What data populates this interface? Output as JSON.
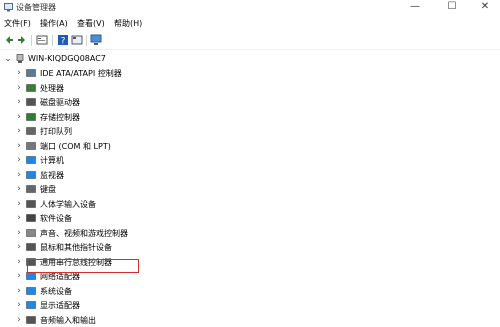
{
  "window": {
    "title": "设备管理器",
    "min": "—",
    "max": "☐",
    "close": "✕"
  },
  "menu": [
    {
      "label": "文件(F)"
    },
    {
      "label": "操作(A)"
    },
    {
      "label": "查看(V)"
    },
    {
      "label": "帮助(H)"
    }
  ],
  "tree": {
    "root": "WIN-KIQDGQ08AC7",
    "items": [
      {
        "label": "IDE ATA/ATAPI 控制器",
        "icon": "ide-controller-icon",
        "color": "#5a7a9a"
      },
      {
        "label": "处理器",
        "icon": "processor-icon",
        "color": "#3a7d3a"
      },
      {
        "label": "磁盘驱动器",
        "icon": "disk-drive-icon",
        "color": "#555555"
      },
      {
        "label": "存储控制器",
        "icon": "storage-controller-icon",
        "color": "#2e7d32"
      },
      {
        "label": "打印队列",
        "icon": "printer-icon",
        "color": "#666666"
      },
      {
        "label": "端口 (COM 和 LPT)",
        "icon": "port-icon",
        "color": "#777777"
      },
      {
        "label": "计算机",
        "icon": "computer-icon",
        "color": "#1e88e5"
      },
      {
        "label": "监视器",
        "icon": "monitor-icon",
        "color": "#1e88e5"
      },
      {
        "label": "键盘",
        "icon": "keyboard-icon",
        "color": "#666666"
      },
      {
        "label": "人体学输入设备",
        "icon": "hid-icon",
        "color": "#555555"
      },
      {
        "label": "软件设备",
        "icon": "software-device-icon",
        "color": "#444444"
      },
      {
        "label": "声音、视频和游戏控制器",
        "icon": "sound-icon",
        "color": "#888888"
      },
      {
        "label": "鼠标和其他指针设备",
        "icon": "mouse-icon",
        "color": "#555555"
      },
      {
        "label": "通用串行总线控制器",
        "icon": "usb-icon",
        "color": "#555555"
      },
      {
        "label": "网络适配器",
        "icon": "network-adapter-icon",
        "color": "#1e88e5"
      },
      {
        "label": "系统设备",
        "icon": "system-device-icon",
        "color": "#1e88e5"
      },
      {
        "label": "显示适配器",
        "icon": "display-adapter-icon",
        "color": "#1e88e5"
      },
      {
        "label": "音频输入和输出",
        "icon": "audio-io-icon",
        "color": "#555555"
      }
    ]
  },
  "highlight_color": "#d32f2f"
}
